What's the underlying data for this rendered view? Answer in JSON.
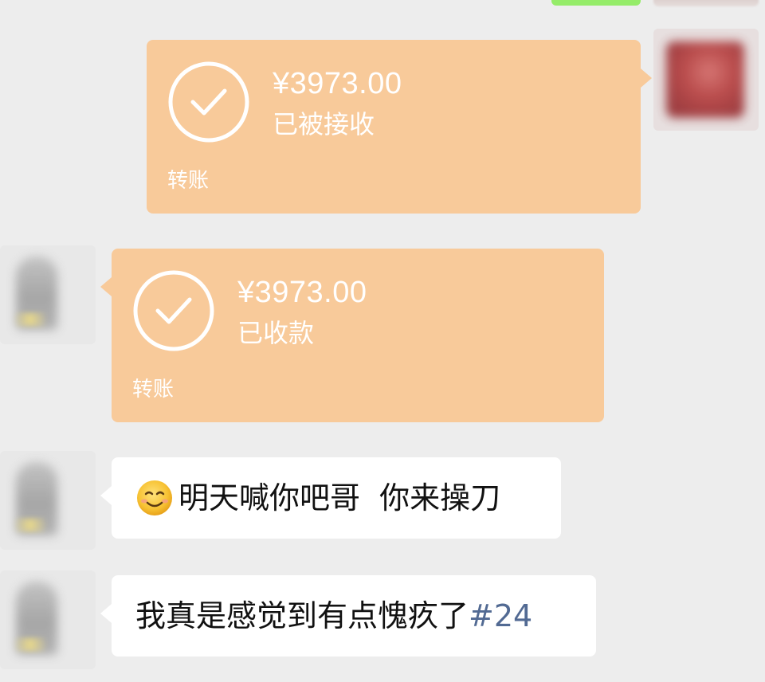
{
  "colors": {
    "background": "#ededed",
    "transfer_bubble": "#f8ca9a",
    "text_bubble": "#ffffff",
    "sent_bubble": "#95ec69",
    "hashtag": "#526a93"
  },
  "messages": [
    {
      "type": "transfer",
      "side": "right",
      "icon": "check-circle-icon",
      "amount": "¥3973.00",
      "status": "已被接收",
      "footer": "转账"
    },
    {
      "type": "transfer",
      "side": "left",
      "icon": "check-circle-icon",
      "amount": "¥3973.00",
      "status": "已收款",
      "footer": "转账"
    },
    {
      "type": "text",
      "side": "left",
      "emoji": "smiling-face-emoji",
      "text": "明天喊你吧哥  你来操刀"
    },
    {
      "type": "text",
      "side": "left",
      "text": "我真是感觉到有点愧疚了",
      "tag": "#24"
    }
  ]
}
